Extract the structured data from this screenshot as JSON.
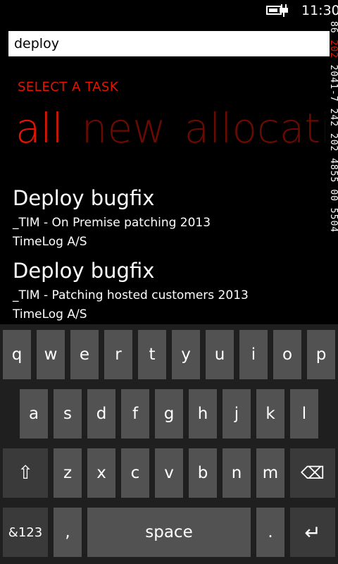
{
  "status": {
    "time": "11:30"
  },
  "search": {
    "value": "deploy"
  },
  "side_id": {
    "part1": "86",
    "part2": "202",
    "part3": "2041-7 242 202 4855 00 5504"
  },
  "header": {
    "title": "SELECT A TASK"
  },
  "pivot": {
    "tabs": [
      "all",
      "new",
      "allocati"
    ]
  },
  "tasks": [
    {
      "title": "Deploy bugfix",
      "project": "_TIM - On Premise patching 2013",
      "customer": "TimeLog A/S"
    },
    {
      "title": "Deploy bugfix",
      "project": "_TIM - Patching hosted customers 2013",
      "customer": "TimeLog A/S"
    }
  ],
  "keyboard": {
    "row1": [
      "q",
      "w",
      "e",
      "r",
      "t",
      "y",
      "u",
      "i",
      "o",
      "p"
    ],
    "row2": [
      "a",
      "s",
      "d",
      "f",
      "g",
      "h",
      "j",
      "k",
      "l"
    ],
    "row3": [
      "z",
      "x",
      "c",
      "v",
      "b",
      "n",
      "m"
    ],
    "shift": "⇧",
    "backspace": "⌫",
    "symbols": "&123",
    "comma": ",",
    "space": "space",
    "period": ".",
    "enter": "↵"
  },
  "colors": {
    "accent": "#e51400",
    "inactive_pivot": "#6b0a00",
    "key": "#525252",
    "key_dark": "#3a3a3a",
    "keyboard_bg": "#1f1f1f"
  }
}
